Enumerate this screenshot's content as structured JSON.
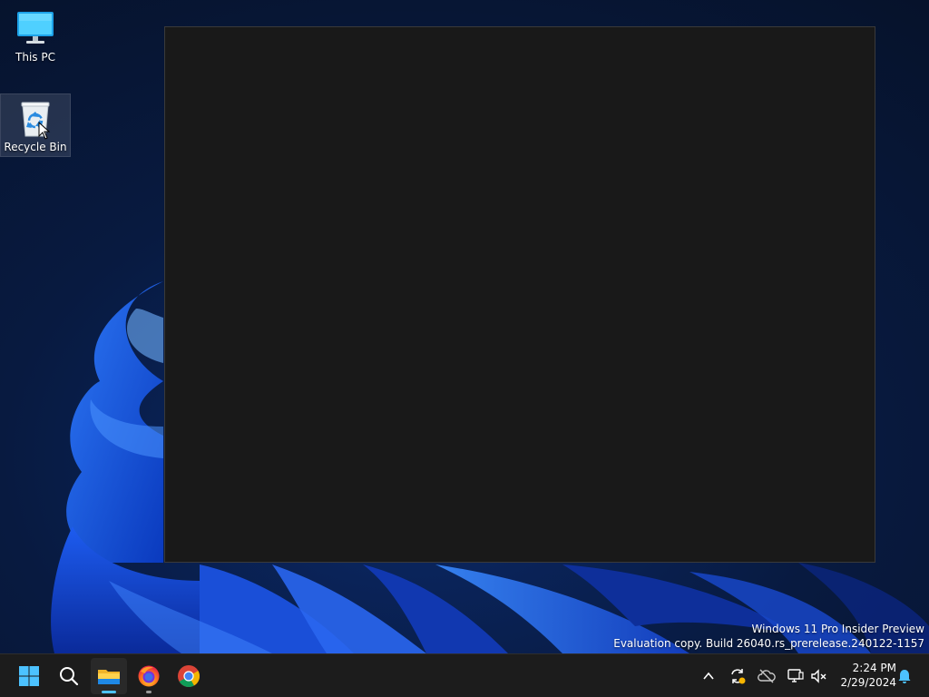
{
  "desktop": {
    "icons": [
      {
        "label": "This PC",
        "icon": "monitor-icon"
      },
      {
        "label": "Recycle Bin",
        "icon": "recycle-bin-icon",
        "selected": true
      }
    ]
  },
  "window": {
    "state": "blank dark window"
  },
  "watermark": {
    "line1": "Windows 11 Pro Insider Preview",
    "line2": "Evaluation copy. Build 26040.rs_prerelease.240122-1157"
  },
  "taskbar": {
    "pinned": [
      {
        "icon": "windows-start-icon"
      },
      {
        "icon": "search-icon"
      },
      {
        "icon": "file-explorer-icon",
        "active": true
      },
      {
        "icon": "firefox-icon",
        "running": true
      },
      {
        "icon": "chrome-icon"
      }
    ],
    "tray": [
      {
        "icon": "chevron-up-icon"
      },
      {
        "icon": "sync-icon"
      },
      {
        "icon": "onedrive-offline-icon"
      },
      {
        "icon": "network-icon"
      },
      {
        "icon": "volume-muted-icon"
      }
    ],
    "clock": {
      "time": "2:24 PM",
      "date": "2/29/2024"
    },
    "notification_icon": "bell-icon"
  },
  "colors": {
    "accent": "#4cc2ff",
    "taskbar_bg": "#1c1c1c",
    "window_bg": "#191919"
  }
}
